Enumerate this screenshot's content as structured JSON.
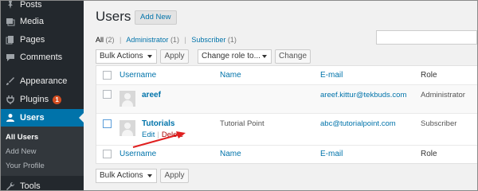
{
  "sidebar": {
    "items": [
      {
        "label": "Posts",
        "icon": "pin-icon"
      },
      {
        "label": "Media",
        "icon": "media-icon"
      },
      {
        "label": "Pages",
        "icon": "pages-icon"
      },
      {
        "label": "Comments",
        "icon": "comments-icon"
      },
      {
        "label": "Appearance",
        "icon": "brush-icon"
      },
      {
        "label": "Plugins",
        "icon": "plug-icon",
        "badge": "1"
      },
      {
        "label": "Users",
        "icon": "user-icon",
        "active": true
      },
      {
        "label": "Tools",
        "icon": "wrench-icon"
      }
    ],
    "submenu": [
      "All Users",
      "Add New",
      "Your Profile"
    ]
  },
  "header": {
    "title": "Users",
    "add_new": "Add New"
  },
  "filters": {
    "all": "All",
    "all_count": "(2)",
    "administrator": "Administrator",
    "administrator_count": "(1)",
    "subscriber": "Subscriber",
    "subscriber_count": "(1)",
    "separator": "|"
  },
  "bulk_actions": {
    "selected": "Bulk Actions",
    "apply": "Apply"
  },
  "change_role": {
    "selected": "Change role to...",
    "button": "Change"
  },
  "table": {
    "columns": {
      "username": "Username",
      "name": "Name",
      "email": "E-mail",
      "role": "Role"
    },
    "rows": [
      {
        "username": "areef",
        "name": "",
        "email": "areef.kittur@tekbuds.com",
        "role": "Administrator"
      },
      {
        "username": "Tutorials",
        "name": "Tutorial Point",
        "email": "abc@tutorialpoint.com",
        "role": "Subscriber",
        "actions": {
          "edit": "Edit",
          "separator": "|",
          "delete": "Delete"
        }
      }
    ]
  },
  "colors": {
    "sidebar": "#23282d",
    "accent": "#0073aa",
    "badge": "#d54e21",
    "delete": "#aa0000",
    "arrow": "#e02020"
  }
}
